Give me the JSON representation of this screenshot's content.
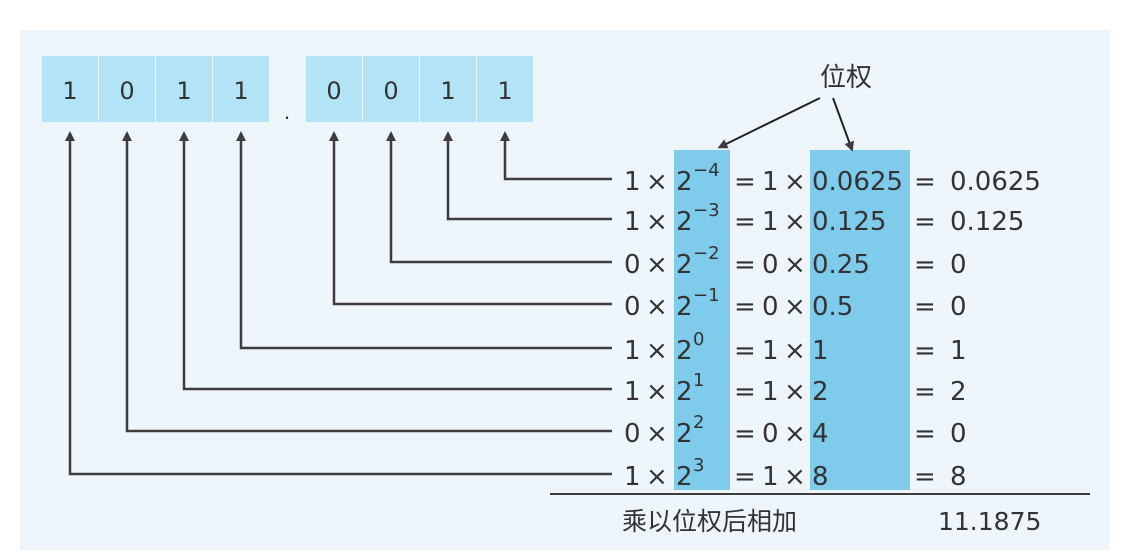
{
  "bits": {
    "integer": [
      "1",
      "0",
      "1",
      "1"
    ],
    "point": ".",
    "fraction": [
      "0",
      "0",
      "1",
      "1"
    ]
  },
  "weight_label": "位权",
  "rows": [
    {
      "digit": "1",
      "exp": "−4",
      "weight": "0.0625",
      "result": "0.0625"
    },
    {
      "digit": "1",
      "exp": "−3",
      "weight": "0.125",
      "result": "0.125"
    },
    {
      "digit": "0",
      "exp": "−2",
      "weight": "0.25",
      "result": "0"
    },
    {
      "digit": "0",
      "exp": "−1",
      "weight": "0.5",
      "result": "0"
    },
    {
      "digit": "1",
      "exp": "0",
      "weight": "1",
      "result": "1"
    },
    {
      "digit": "1",
      "exp": "1",
      "weight": "2",
      "result": "2"
    },
    {
      "digit": "0",
      "exp": "2",
      "weight": "4",
      "result": "0"
    },
    {
      "digit": "1",
      "exp": "3",
      "weight": "8",
      "result": "8"
    }
  ],
  "symbols": {
    "times": "×",
    "two": "2",
    "equals": "="
  },
  "footer": {
    "label": "乘以位权后相加",
    "total": "11.1875"
  },
  "colors": {
    "panel_bg": "#eef6fb",
    "bit_box": "#b3e3f7",
    "weight_column": "#7ecbeb",
    "arrow": "#3d3d3d",
    "text": "#333333"
  }
}
